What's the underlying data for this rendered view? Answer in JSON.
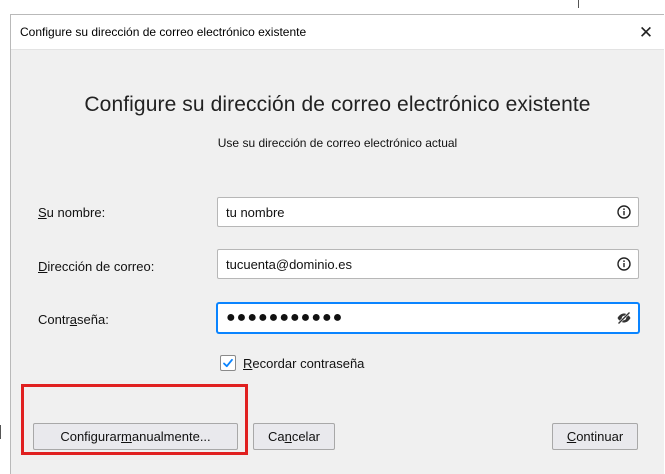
{
  "window": {
    "title": "Configure su dirección de correo electrónico existente",
    "close_glyph": "✕"
  },
  "dialog": {
    "heading": "Configure su dirección de correo electrónico existente",
    "subheading": "Use su dirección de correo electrónico actual"
  },
  "fields": {
    "name": {
      "label_pre": "",
      "label_key": "S",
      "label_post": "u nombre:",
      "value": "tu nombre",
      "icon": "info-icon"
    },
    "email": {
      "label_pre": "",
      "label_key": "D",
      "label_post": "irección de correo:",
      "value": "tucuenta@dominio.es",
      "icon": "info-icon"
    },
    "password": {
      "label_pre": "Contr",
      "label_key": "a",
      "label_post": "seña:",
      "value": "●●●●●●●●●●●",
      "icon": "eye-slash-icon"
    }
  },
  "remember": {
    "checked": true,
    "label_key": "R",
    "label_post": "ecordar contraseña"
  },
  "buttons": {
    "manual": {
      "pre": "Configurar ",
      "key": "m",
      "post": "anualmente..."
    },
    "cancel": {
      "pre": "Ca",
      "key": "n",
      "post": "celar"
    },
    "continue": {
      "pre": "",
      "key": "C",
      "post": "ontinuar"
    }
  },
  "colors": {
    "focus": "#0a84ff",
    "highlight": "#e02020",
    "checkmark": "#0a84ff"
  }
}
